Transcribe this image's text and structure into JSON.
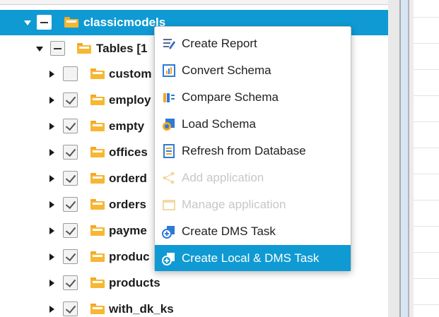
{
  "tree": {
    "root": {
      "label": "classicmodels"
    },
    "tables_group": {
      "label": "Tables [1"
    },
    "items": [
      {
        "label": "custom",
        "checked": false
      },
      {
        "label": "employ",
        "checked": true
      },
      {
        "label": "empty",
        "checked": true
      },
      {
        "label": "offices",
        "checked": true
      },
      {
        "label": "orderd",
        "checked": true
      },
      {
        "label": "orders",
        "checked": true
      },
      {
        "label": "payme",
        "checked": true
      },
      {
        "label": "produc",
        "checked": true
      },
      {
        "label": "products",
        "checked": true
      },
      {
        "label": "with_dk_ks",
        "checked": true
      }
    ]
  },
  "context_menu": {
    "items": [
      {
        "label": "Create Report",
        "icon": "report-icon",
        "enabled": true
      },
      {
        "label": "Convert Schema",
        "icon": "convert-schema-icon",
        "enabled": true
      },
      {
        "label": "Compare Schema",
        "icon": "compare-schema-icon",
        "enabled": true
      },
      {
        "label": "Load Schema",
        "icon": "load-schema-icon",
        "enabled": true
      },
      {
        "label": "Refresh from Database",
        "icon": "refresh-database-icon",
        "enabled": true
      },
      {
        "label": "Add application",
        "icon": "add-application-icon",
        "enabled": false
      },
      {
        "label": "Manage application",
        "icon": "manage-application-icon",
        "enabled": false
      },
      {
        "label": "Create DMS Task",
        "icon": "dms-task-icon",
        "enabled": true
      },
      {
        "label": "Create Local & DMS Task",
        "icon": "local-dms-task-icon",
        "enabled": true,
        "highlighted": true
      }
    ]
  },
  "colors": {
    "accent": "#0f9ad3",
    "folder": "#f7b733",
    "disabled_text": "#c7c7c7"
  }
}
